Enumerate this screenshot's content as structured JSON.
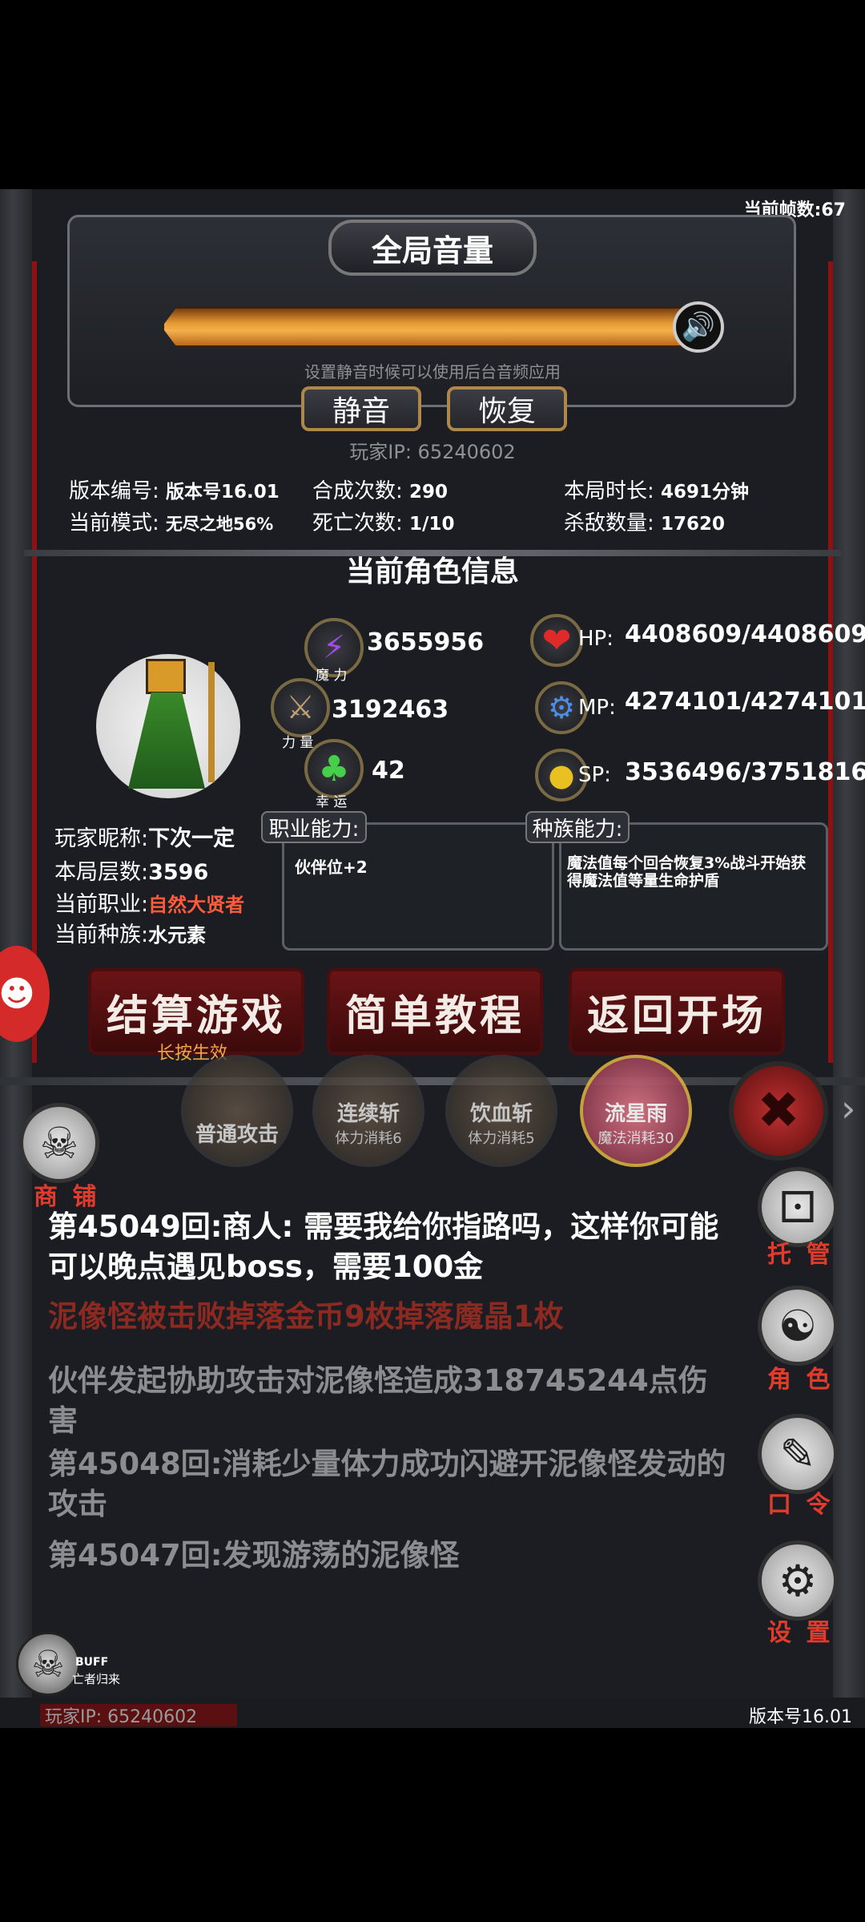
{
  "fps": {
    "label": "当前帧数:67"
  },
  "volume": {
    "title": "全局音量",
    "hint": "设置静音时候可以使用后台音频应用",
    "level": 1.0,
    "mute_label": "静音",
    "restore_label": "恢复",
    "player_ip": "玩家IP:  65240602"
  },
  "stats": {
    "version": {
      "label": "版本编号:",
      "value": "版本号16.01"
    },
    "mode": {
      "label": "当前模式:",
      "value": "无尽之地56%"
    },
    "synth": {
      "label": "合成次数:",
      "value": "290"
    },
    "deaths": {
      "label": "死亡次数:",
      "value": "1/10"
    },
    "duration": {
      "label": "本局时长:",
      "value": "4691分钟"
    },
    "kills": {
      "label": "杀敌数量:",
      "value": "17620"
    }
  },
  "character": {
    "section_title": "当前角色信息",
    "magic": {
      "value": "3655956",
      "caption": "魔 力"
    },
    "strength": {
      "value": "3192463",
      "caption": "力 量"
    },
    "luck": {
      "value": "42",
      "caption": "幸 运"
    },
    "hp": {
      "label": "HP:",
      "value": "4408609/4408609"
    },
    "mp": {
      "label": "MP:",
      "value": "4274101/4274101"
    },
    "sp": {
      "label": "SP:",
      "value": "3536496/3751816"
    },
    "nickname": {
      "label": "玩家昵称:",
      "value": "下次一定"
    },
    "floor": {
      "label": "本局层数:",
      "value": "3596"
    },
    "job": {
      "label": "当前职业:",
      "value": "自然大贤者"
    },
    "race": {
      "label": "当前种族:",
      "value": "水元素"
    },
    "job_ability": {
      "title": "职业能力:",
      "text": "伙伴位+2"
    },
    "race_ability": {
      "title": "种族能力:",
      "text": "魔法值每个回合恢复3%战斗开始获得魔法值等量生命护盾"
    }
  },
  "buttons": {
    "settle": "结算游戏",
    "settle_sub": "长按生效",
    "tutorial": "简单教程",
    "return": "返回开场"
  },
  "skills": [
    {
      "name": "普通攻击",
      "cost": ""
    },
    {
      "name": "连续斩",
      "cost": "体力消耗6"
    },
    {
      "name": "饮血斩",
      "cost": "体力消耗5"
    },
    {
      "name": "流星雨",
      "cost": "魔法消耗30"
    }
  ],
  "side": {
    "shop": "商 铺",
    "auto": "托 管",
    "role": "角 色",
    "code": "口 令",
    "settings": "设 置"
  },
  "log": [
    {
      "text": "第45049回:商人:  需要我给你指路吗，这样你可能可以晚点遇见boss，需要100金",
      "color": "#ffffff"
    },
    {
      "text": "泥像怪被击败掉落金币9枚掉落魔晶1枚",
      "color": "#8c2a22"
    },
    {
      "text": "伙伴发起协助攻击对泥像怪造成318745244点伤害",
      "color": "#8b8d91"
    },
    {
      "text": "第45048回:消耗少量体力成功闪避开泥像怪发动的攻击",
      "color": "#8b8d91"
    },
    {
      "text": "第45047回:发现游荡的泥像怪",
      "color": "#8b8d91"
    }
  ],
  "buff": {
    "label": "BUFF",
    "name": "亡者归来"
  },
  "footer": {
    "ip": "玩家IP:  65240602",
    "version": "版本号16.01"
  },
  "colors": {
    "accent_orange": "#f2a640",
    "job_red": "#ff5a3c",
    "log_red": "#8c2a22"
  }
}
